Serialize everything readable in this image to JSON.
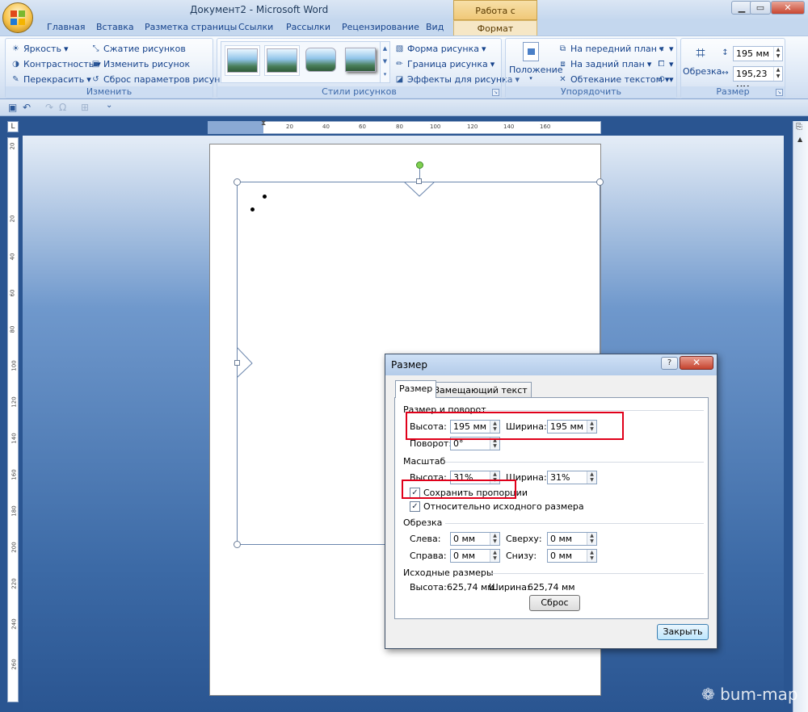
{
  "app": {
    "title": "Документ2 - Microsoft Word",
    "context_title": "Работа с рисунками"
  },
  "window": {
    "minimize": "▁",
    "maximize": "▭",
    "close": "✕"
  },
  "tabs": [
    "Главная",
    "Вставка",
    "Разметка страницы",
    "Ссылки",
    "Рассылки",
    "Рецензирование",
    "Вид"
  ],
  "active_tab": "Формат",
  "help_glyph": "?",
  "ribbon": {
    "adjust": {
      "label": "Изменить",
      "brightness": "Яркость",
      "contrast": "Контрастность",
      "recolor": "Перекрасить",
      "compress": "Сжатие рисунков",
      "change": "Изменить рисунок",
      "reset": "Сброс параметров рисунка"
    },
    "styles": {
      "label": "Стили рисунков",
      "shape": "Форма рисунка",
      "border": "Граница рисунка",
      "effects": "Эффекты для рисунка"
    },
    "arrange": {
      "label": "Упорядочить",
      "position": "Положение",
      "front": "На передний план",
      "back": "На задний план",
      "wrap": "Обтекание текстом"
    },
    "size": {
      "label": "Размер",
      "crop": "Обрезка",
      "height": "195 мм",
      "width": "195,23 мм"
    }
  },
  "hruler_ticks": [
    "20",
    "20",
    "40",
    "60",
    "80",
    "100",
    "120",
    "140",
    "160"
  ],
  "vruler_ticks": [
    "20",
    "20",
    "40",
    "60",
    "80",
    "100",
    "120",
    "140",
    "160",
    "180",
    "200",
    "220",
    "240",
    "260"
  ],
  "ruler_corner": "L",
  "dialog": {
    "title": "Размер",
    "help": "?",
    "close": "✕",
    "tab_size": "Размер",
    "tab_alt": "Замещающий текст",
    "sec_size_rotate": "Размер и поворот",
    "height_label": "Высота:",
    "height_value": "195 мм",
    "width_label": "Ширина:",
    "width_value": "195 мм",
    "rotation_label": "Поворот:",
    "rotation_value": "0°",
    "sec_scale": "Масштаб",
    "scale_height_label": "Высота:",
    "scale_height_value": "31%",
    "scale_width_label": "Ширина:",
    "scale_width_value": "31%",
    "lock_aspect": "Сохранить пропорции",
    "lock_aspect_checked": "✓",
    "relative_original": "Относительно исходного размера",
    "relative_checked": "✓",
    "sec_crop": "Обрезка",
    "crop_left_label": "Слева:",
    "crop_left_value": "0 мм",
    "crop_top_label": "Сверху:",
    "crop_top_value": "0 мм",
    "crop_right_label": "Справа:",
    "crop_right_value": "0 мм",
    "crop_bottom_label": "Снизу:",
    "crop_bottom_value": "0 мм",
    "sec_original": "Исходные размеры",
    "orig_height_label": "Высота:",
    "orig_height_value": "625,74 мм",
    "orig_width_label": "Ширина:",
    "orig_width_value": "625,74 мм",
    "reset_btn": "Сброс",
    "close_btn": "Закрыть"
  },
  "watermark": "❁ bum-map"
}
